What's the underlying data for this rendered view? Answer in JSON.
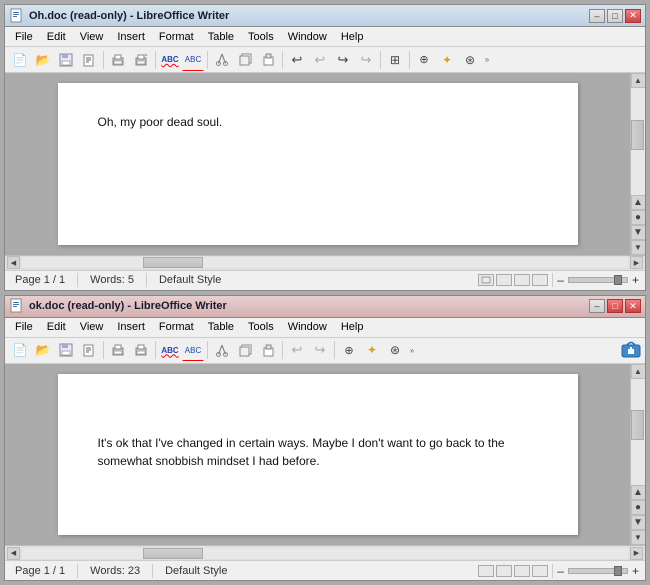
{
  "window1": {
    "title": "Oh.doc (read-only) - LibreOffice Writer",
    "menu": {
      "items": [
        "File",
        "Edit",
        "View",
        "Insert",
        "Format",
        "Table",
        "Tools",
        "Window",
        "Help"
      ]
    },
    "content": "Oh, my poor dead soul.",
    "statusbar": {
      "page": "Page 1 / 1",
      "words": "Words: 5",
      "style": "Default Style"
    },
    "controls": {
      "minimize": "–",
      "maximize": "□",
      "close": "✕"
    }
  },
  "window2": {
    "title": "ok.doc (read-only) - LibreOffice Writer",
    "menu": {
      "items": [
        "File",
        "Edit",
        "View",
        "Insert",
        "Format",
        "Table",
        "Tools",
        "Window",
        "Help"
      ]
    },
    "content": "It's ok that I've changed in certain ways. Maybe I don't want to go back to the somewhat snobbish mindset I had before.",
    "statusbar": {
      "page": "Page 1 / 1",
      "words": "Words: 23",
      "style": "Default Style"
    },
    "controls": {
      "minimize": "–",
      "maximize": "□",
      "close": "✕"
    }
  },
  "icons": {
    "chevron_right": "»"
  }
}
